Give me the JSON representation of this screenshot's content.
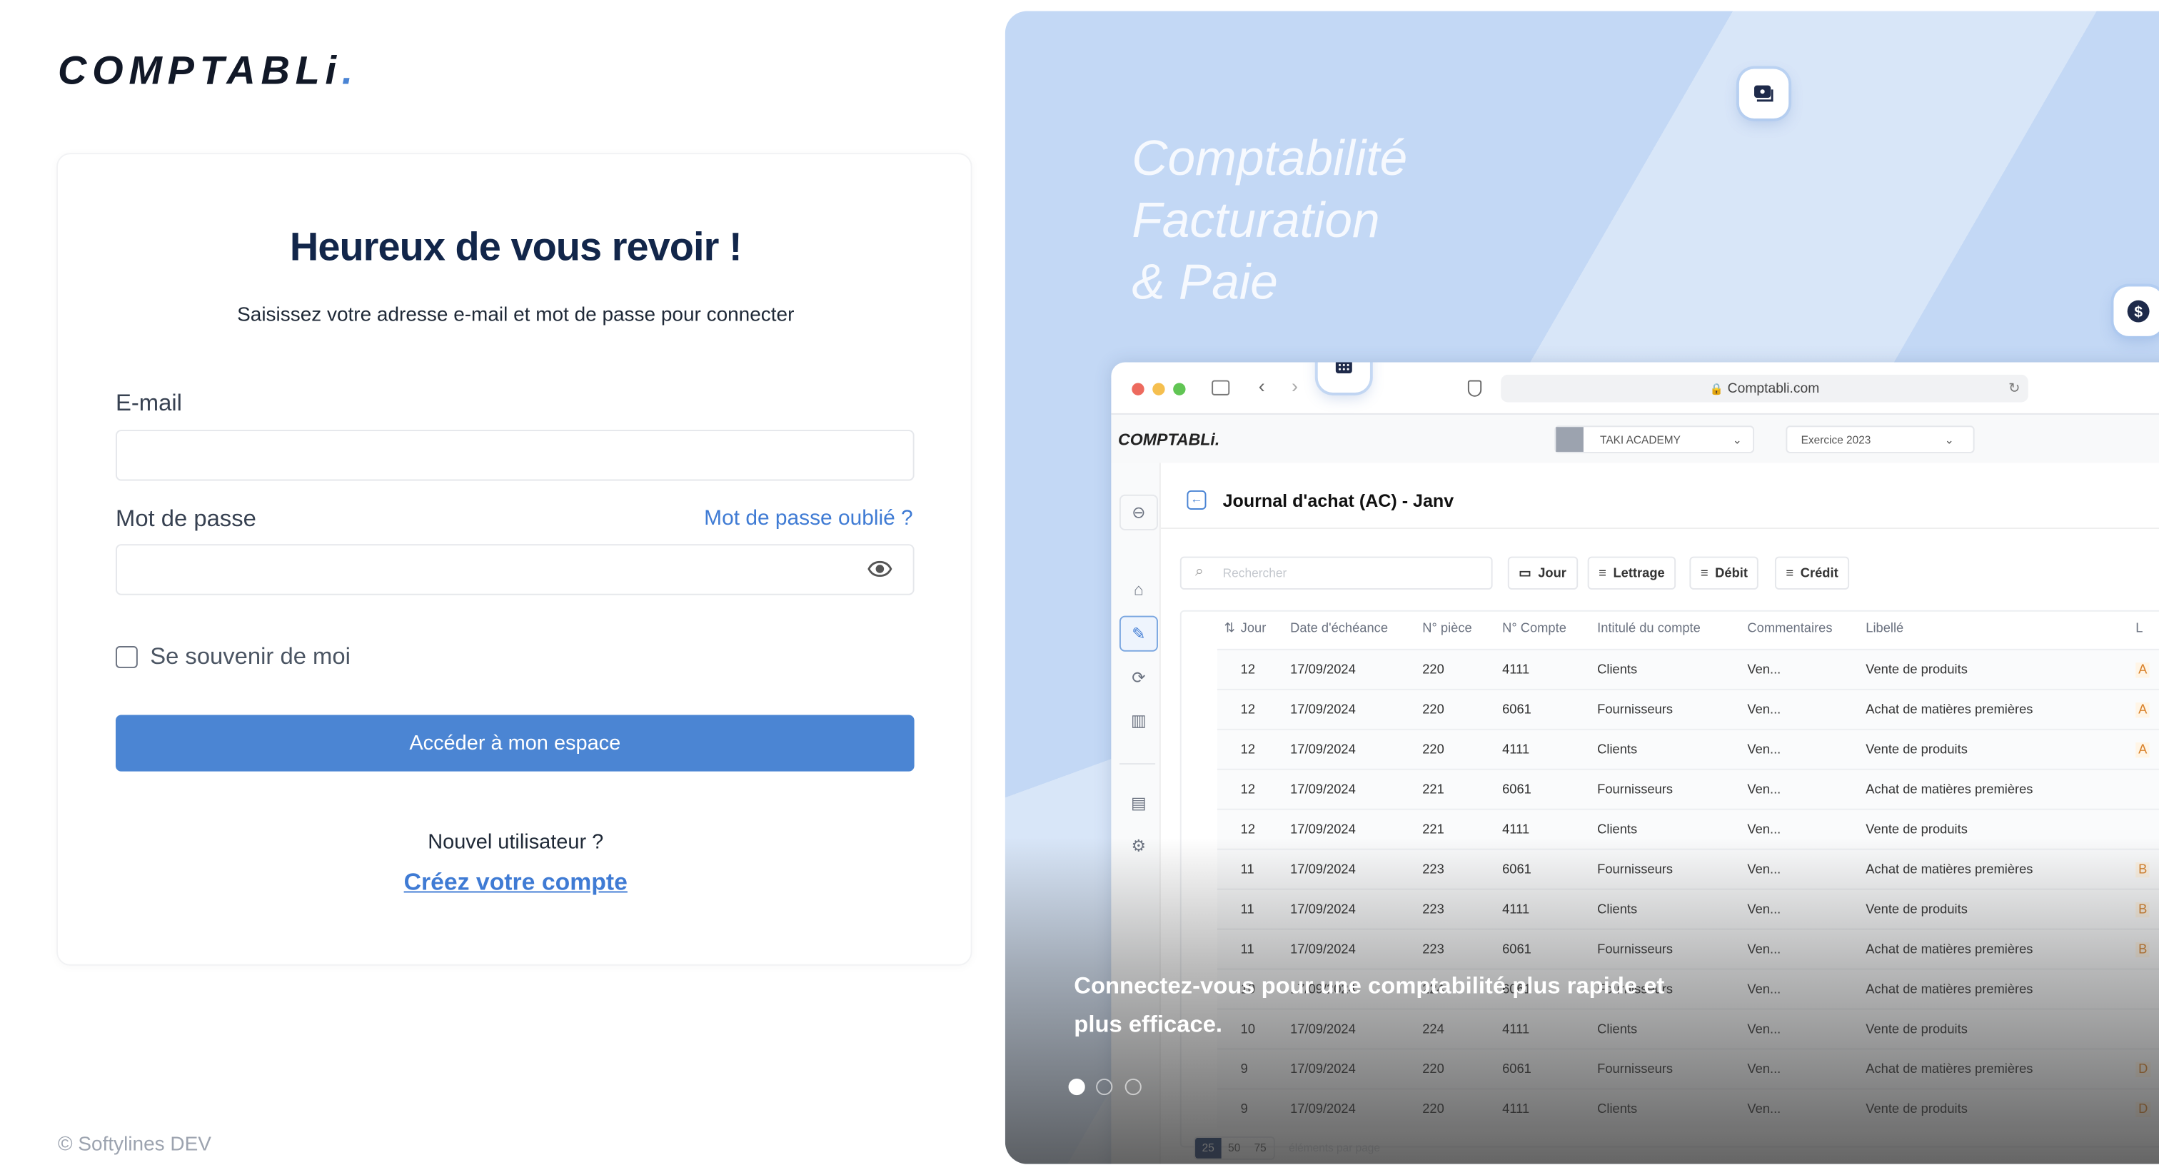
{
  "brand": {
    "name": "COMPTABLi",
    "dot": "."
  },
  "login": {
    "title": "Heureux de vous revoir !",
    "subtitle": "Saisissez votre adresse e-mail et mot de passe pour connecter",
    "email_label": "E-mail",
    "email_value": "",
    "password_label": "Mot de passe",
    "password_value": "",
    "forgot_link": "Mot de passe oublié ?",
    "remember_label": "Se souvenir de moi",
    "submit_label": "Accéder à mon espace",
    "new_user_text": "Nouvel utilisateur ?",
    "create_account_link": "Créez votre compte"
  },
  "footer": {
    "copyright": "© Softylines DEV"
  },
  "promo": {
    "tagline": [
      "Comptabilité",
      "Facturation",
      "& Paie"
    ],
    "caption": "Connectez-vous pour une comptabilité plus rapide et plus efficace.",
    "carousel": {
      "count": 3,
      "active": 1
    }
  },
  "browser": {
    "url": "Comptabli.com"
  },
  "app": {
    "logo": "COMPTABLi.",
    "company": "TAKI ACADEMY",
    "exercise": "Exercice 2023",
    "page_title": "Journal d'achat (AC) - Janv",
    "search_placeholder": "Rechercher",
    "filters": [
      "Jour",
      "Lettrage",
      "Débit",
      "Crédit"
    ],
    "columns": [
      "Jour",
      "Date d'échéance",
      "N° pièce",
      "N° Compte",
      "Intitulé du compte",
      "Commentaires",
      "Libellé",
      "L"
    ],
    "rows": [
      [
        "12",
        "17/09/2024",
        "220",
        "4111",
        "Clients",
        "Ven...",
        "Vente de produits",
        "A"
      ],
      [
        "12",
        "17/09/2024",
        "220",
        "6061",
        "Fournisseurs",
        "Ven...",
        "Achat de matières premières",
        "A"
      ],
      [
        "12",
        "17/09/2024",
        "220",
        "4111",
        "Clients",
        "Ven...",
        "Vente de produits",
        "A"
      ],
      [
        "12",
        "17/09/2024",
        "221",
        "6061",
        "Fournisseurs",
        "Ven...",
        "Achat de matières premières",
        ""
      ],
      [
        "12",
        "17/09/2024",
        "221",
        "4111",
        "Clients",
        "Ven...",
        "Vente de produits",
        ""
      ],
      [
        "11",
        "17/09/2024",
        "223",
        "6061",
        "Fournisseurs",
        "Ven...",
        "Achat de matières premières",
        "B"
      ],
      [
        "11",
        "17/09/2024",
        "223",
        "4111",
        "Clients",
        "Ven...",
        "Vente de produits",
        "B"
      ],
      [
        "11",
        "17/09/2024",
        "223",
        "6061",
        "Fournisseurs",
        "Ven...",
        "Achat de matières premières",
        "B"
      ],
      [
        "10",
        "17/09/2024",
        "224",
        "6061",
        "Fournisseurs",
        "Ven...",
        "Achat de matières premières",
        ""
      ],
      [
        "10",
        "17/09/2024",
        "224",
        "4111",
        "Clients",
        "Ven...",
        "Vente de produits",
        ""
      ],
      [
        "9",
        "17/09/2024",
        "220",
        "6061",
        "Fournisseurs",
        "Ven...",
        "Achat de matières premières",
        "D"
      ],
      [
        "9",
        "17/09/2024",
        "220",
        "4111",
        "Clients",
        "Ven...",
        "Vente de produits",
        "D"
      ]
    ],
    "page_sizes": [
      "25",
      "50",
      "75"
    ],
    "page_size_label": "éléments par page"
  },
  "colors": {
    "accent": "#4b85d3",
    "title": "#12264a",
    "panel": "#c3d8f5"
  }
}
